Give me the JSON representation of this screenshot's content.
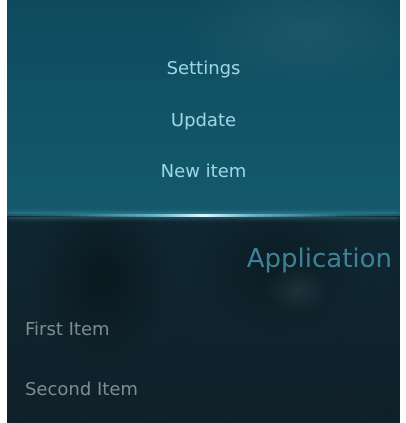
{
  "pulley_menu": {
    "items": [
      {
        "label": "Settings"
      },
      {
        "label": "Update"
      },
      {
        "label": "New item"
      }
    ]
  },
  "page": {
    "header": "Application",
    "list": [
      {
        "label": "First Item"
      },
      {
        "label": "Second Item"
      }
    ]
  },
  "colors": {
    "menu_background": "#115467",
    "menu_text": "#9fd6e6",
    "page_background": "#0e2530",
    "header_text": "#3e8196",
    "list_text": "#7d8d94",
    "highlight_line": "#dcfaff"
  }
}
